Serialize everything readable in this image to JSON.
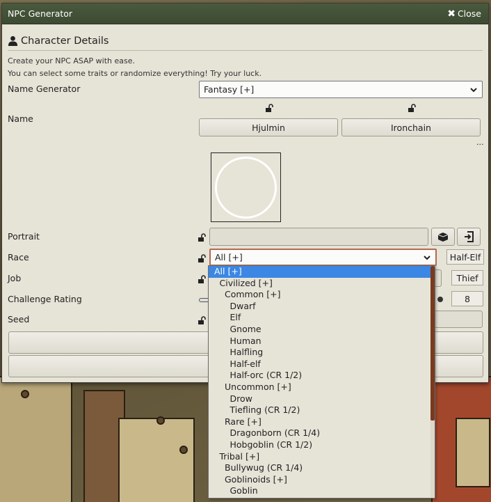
{
  "window": {
    "title": "NPC Generator",
    "close_label": "Close"
  },
  "section": {
    "title": "Character Details"
  },
  "description": {
    "line1": "Create your NPC ASAP with ease.",
    "line2": "You can select some traits or randomize everything! Try your luck."
  },
  "fields": {
    "name_generator": {
      "label": "Name Generator",
      "value": "Fantasy [+]"
    },
    "name": {
      "label": "Name",
      "first": "Hjulmin",
      "last": "Ironchain",
      "more": "..."
    },
    "portrait": {
      "label": "Portrait",
      "value": ""
    },
    "race": {
      "label": "Race",
      "value": "All [+]",
      "result": "Half-Elf"
    },
    "job": {
      "label": "Job",
      "result": "Thief"
    },
    "challenge_rating": {
      "label": "Challenge Rating",
      "value": "8"
    },
    "seed": {
      "label": "Seed"
    }
  },
  "race_options": [
    {
      "label": "All [+]",
      "level": 0,
      "selected": true
    },
    {
      "label": "Civilized [+]",
      "level": 1
    },
    {
      "label": "Common [+]",
      "level": 2
    },
    {
      "label": "Dwarf",
      "level": 3
    },
    {
      "label": "Elf",
      "level": 3
    },
    {
      "label": "Gnome",
      "level": 3
    },
    {
      "label": "Human",
      "level": 3
    },
    {
      "label": "Halfling",
      "level": 3
    },
    {
      "label": "Half-elf",
      "level": 3
    },
    {
      "label": "Half-orc (CR 1/2)",
      "level": 3
    },
    {
      "label": "Uncommon [+]",
      "level": 2
    },
    {
      "label": "Drow",
      "level": 3
    },
    {
      "label": "Tiefling (CR 1/2)",
      "level": 3
    },
    {
      "label": "Rare [+]",
      "level": 2
    },
    {
      "label": "Dragonborn (CR 1/4)",
      "level": 3
    },
    {
      "label": "Hobgoblin (CR 1/2)",
      "level": 3
    },
    {
      "label": "Tribal [+]",
      "level": 1
    },
    {
      "label": "Bullywug (CR 1/4)",
      "level": 2
    },
    {
      "label": "Goblinoids [+]",
      "level": 2
    },
    {
      "label": "Goblin",
      "level": 3
    }
  ],
  "colors": {
    "titlebar": "#3c4a32",
    "highlight": "#3b87e3",
    "accent": "#7a3a20"
  }
}
